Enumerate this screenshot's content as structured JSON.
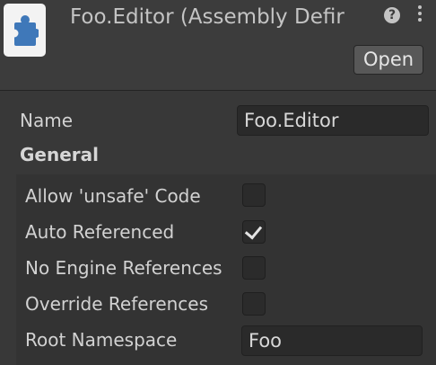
{
  "header": {
    "title": "Foo.Editor (Assembly Defir",
    "open_label": "Open",
    "help_glyph": "?"
  },
  "name": {
    "label": "Name",
    "value": "Foo.Editor"
  },
  "general": {
    "title": "General",
    "options": [
      {
        "label": "Allow 'unsafe' Code",
        "checked": false
      },
      {
        "label": "Auto Referenced",
        "checked": true
      },
      {
        "label": "No Engine References",
        "checked": false
      },
      {
        "label": "Override References",
        "checked": false
      }
    ],
    "root_namespace": {
      "label": "Root Namespace",
      "value": "Foo"
    }
  },
  "colors": {
    "background": "#383838",
    "header": "#3c3c3c",
    "field": "#2a2a2a",
    "icon_accent": "#3f78b9"
  }
}
